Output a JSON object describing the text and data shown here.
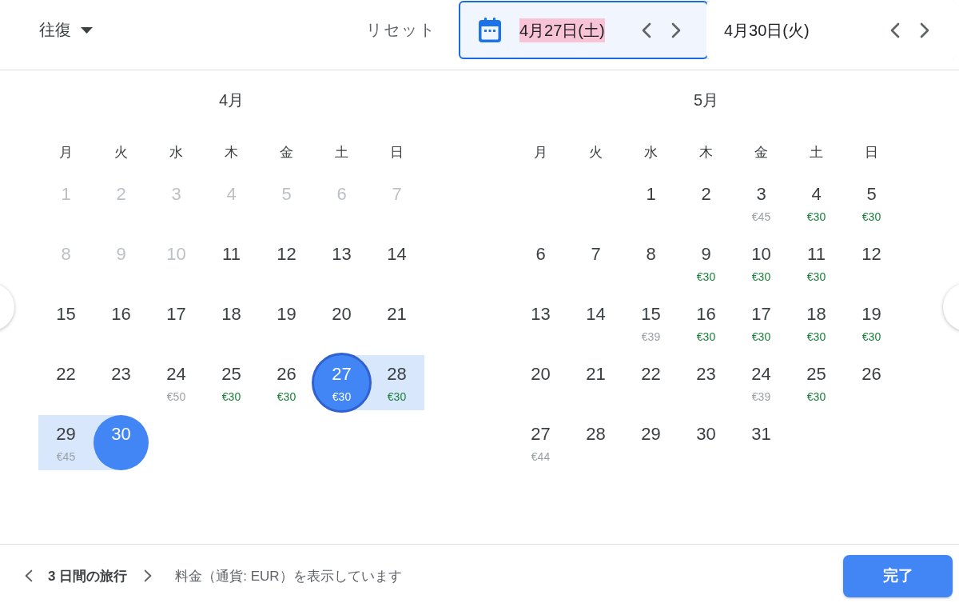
{
  "header": {
    "trip_type": "往復",
    "reset": "リセット",
    "date_fields": [
      {
        "value": "4月27日(土)",
        "selected": true,
        "text_highlighted": true
      },
      {
        "value": "4月30日(火)",
        "selected": false,
        "text_highlighted": false
      }
    ]
  },
  "months": [
    {
      "title": "4月",
      "weekdays": [
        "月",
        "火",
        "水",
        "木",
        "金",
        "土",
        "日"
      ],
      "weeks": [
        [
          {
            "day": "1",
            "disabled": true,
            "selected": false,
            "in_range": false
          },
          {
            "day": "2",
            "disabled": true,
            "selected": false,
            "in_range": false
          },
          {
            "day": "3",
            "disabled": true,
            "selected": false,
            "in_range": false
          },
          {
            "day": "4",
            "disabled": true,
            "selected": false,
            "in_range": false
          },
          {
            "day": "5",
            "disabled": true,
            "selected": false,
            "in_range": false
          },
          {
            "day": "6",
            "disabled": true,
            "selected": false,
            "in_range": false
          },
          {
            "day": "7",
            "disabled": true,
            "selected": false,
            "in_range": false
          }
        ],
        [
          {
            "day": "8",
            "disabled": true,
            "selected": false,
            "in_range": false
          },
          {
            "day": "9",
            "disabled": true,
            "selected": false,
            "in_range": false
          },
          {
            "day": "10",
            "disabled": true,
            "selected": false,
            "in_range": false
          },
          {
            "day": "11",
            "disabled": false,
            "selected": false,
            "in_range": false
          },
          {
            "day": "12",
            "disabled": false,
            "selected": false,
            "in_range": false
          },
          {
            "day": "13",
            "disabled": false,
            "selected": false,
            "in_range": false
          },
          {
            "day": "14",
            "disabled": false,
            "selected": false,
            "in_range": false
          }
        ],
        [
          {
            "day": "15",
            "disabled": false,
            "selected": false,
            "in_range": false
          },
          {
            "day": "16",
            "disabled": false,
            "selected": false,
            "in_range": false
          },
          {
            "day": "17",
            "disabled": false,
            "selected": false,
            "in_range": false
          },
          {
            "day": "18",
            "disabled": false,
            "selected": false,
            "in_range": false
          },
          {
            "day": "19",
            "disabled": false,
            "selected": false,
            "in_range": false
          },
          {
            "day": "20",
            "disabled": false,
            "selected": false,
            "in_range": false
          },
          {
            "day": "21",
            "disabled": false,
            "selected": false,
            "in_range": false
          }
        ],
        [
          {
            "day": "22",
            "disabled": false,
            "selected": false,
            "in_range": false
          },
          {
            "day": "23",
            "disabled": false,
            "selected": false,
            "in_range": false
          },
          {
            "day": "24",
            "disabled": false,
            "selected": false,
            "in_range": false,
            "price": "€50",
            "low_price": false
          },
          {
            "day": "25",
            "disabled": false,
            "selected": false,
            "in_range": false,
            "price": "€30",
            "low_price": true
          },
          {
            "day": "26",
            "disabled": false,
            "selected": false,
            "in_range": false,
            "price": "€30",
            "low_price": true
          },
          {
            "day": "27",
            "disabled": false,
            "selected": true,
            "focused": true,
            "in_range": false,
            "price": "€30",
            "low_price": true
          },
          {
            "day": "28",
            "disabled": false,
            "selected": false,
            "in_range": true,
            "price": "€30",
            "low_price": true
          }
        ],
        [
          {
            "day": "29",
            "disabled": false,
            "selected": false,
            "in_range": true,
            "price": "€45",
            "low_price": false
          },
          {
            "day": "30",
            "disabled": false,
            "selected": true,
            "focused": false,
            "in_range": false
          }
        ]
      ]
    },
    {
      "title": "5月",
      "weekdays": [
        "月",
        "火",
        "水",
        "木",
        "金",
        "土",
        "日"
      ],
      "weeks": [
        [
          {
            "day": "1",
            "disabled": false,
            "selected": false,
            "in_range": false
          },
          {
            "day": "2",
            "disabled": false,
            "selected": false,
            "in_range": false
          },
          {
            "day": "3",
            "disabled": false,
            "selected": false,
            "in_range": false,
            "price": "€45",
            "low_price": false
          },
          {
            "day": "4",
            "disabled": false,
            "selected": false,
            "in_range": false,
            "price": "€30",
            "low_price": true
          },
          {
            "day": "5",
            "disabled": false,
            "selected": false,
            "in_range": false,
            "price": "€30",
            "low_price": true
          }
        ],
        [
          {
            "day": "6",
            "disabled": false,
            "selected": false,
            "in_range": false
          },
          {
            "day": "7",
            "disabled": false,
            "selected": false,
            "in_range": false
          },
          {
            "day": "8",
            "disabled": false,
            "selected": false,
            "in_range": false
          },
          {
            "day": "9",
            "disabled": false,
            "selected": false,
            "in_range": false,
            "price": "€30",
            "low_price": true
          },
          {
            "day": "10",
            "disabled": false,
            "selected": false,
            "in_range": false,
            "price": "€30",
            "low_price": true
          },
          {
            "day": "11",
            "disabled": false,
            "selected": false,
            "in_range": false,
            "price": "€30",
            "low_price": true
          },
          {
            "day": "12",
            "disabled": false,
            "selected": false,
            "in_range": false
          }
        ],
        [
          {
            "day": "13",
            "disabled": false,
            "selected": false,
            "in_range": false
          },
          {
            "day": "14",
            "disabled": false,
            "selected": false,
            "in_range": false
          },
          {
            "day": "15",
            "disabled": false,
            "selected": false,
            "in_range": false,
            "price": "€39",
            "low_price": false
          },
          {
            "day": "16",
            "disabled": false,
            "selected": false,
            "in_range": false,
            "price": "€30",
            "low_price": true
          },
          {
            "day": "17",
            "disabled": false,
            "selected": false,
            "in_range": false,
            "price": "€30",
            "low_price": true
          },
          {
            "day": "18",
            "disabled": false,
            "selected": false,
            "in_range": false,
            "price": "€30",
            "low_price": true
          },
          {
            "day": "19",
            "disabled": false,
            "selected": false,
            "in_range": false,
            "price": "€30",
            "low_price": true
          }
        ],
        [
          {
            "day": "20",
            "disabled": false,
            "selected": false,
            "in_range": false
          },
          {
            "day": "21",
            "disabled": false,
            "selected": false,
            "in_range": false
          },
          {
            "day": "22",
            "disabled": false,
            "selected": false,
            "in_range": false
          },
          {
            "day": "23",
            "disabled": false,
            "selected": false,
            "in_range": false
          },
          {
            "day": "24",
            "disabled": false,
            "selected": false,
            "in_range": false,
            "price": "€39",
            "low_price": false
          },
          {
            "day": "25",
            "disabled": false,
            "selected": false,
            "in_range": false,
            "price": "€30",
            "low_price": true
          },
          {
            "day": "26",
            "disabled": false,
            "selected": false,
            "in_range": false
          }
        ],
        [
          {
            "day": "27",
            "disabled": false,
            "selected": false,
            "in_range": false,
            "price": "€44",
            "low_price": false
          },
          {
            "day": "28",
            "disabled": false,
            "selected": false,
            "in_range": false
          },
          {
            "day": "29",
            "disabled": false,
            "selected": false,
            "in_range": false
          },
          {
            "day": "30",
            "disabled": false,
            "selected": false,
            "in_range": false
          },
          {
            "day": "31",
            "disabled": false,
            "selected": false,
            "in_range": false
          }
        ]
      ]
    }
  ],
  "footer": {
    "trip_length": "3 日間の旅行",
    "currency_note": "料金（通貨: EUR）を表示しています",
    "done": "完了"
  }
}
